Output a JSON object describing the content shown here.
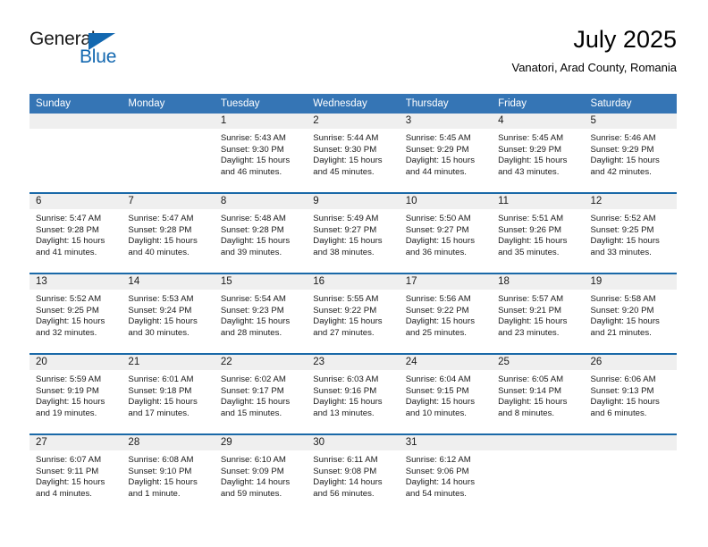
{
  "brand": {
    "name_top": "General",
    "name_bottom": "Blue",
    "triangle_color": "#1368b0",
    "text_color": "#1a1a1a"
  },
  "header": {
    "title": "July 2025",
    "subtitle": "Vanatori, Arad County, Romania"
  },
  "theme": {
    "header_blue": "#3575b5",
    "row_divider_blue": "#1a69a8",
    "day_band_gray": "#efefef"
  },
  "calendar": {
    "weekdays": [
      "Sunday",
      "Monday",
      "Tuesday",
      "Wednesday",
      "Thursday",
      "Friday",
      "Saturday"
    ],
    "weeks": [
      [
        {
          "day": "",
          "sunrise": "",
          "sunset": "",
          "daylight_line1": "",
          "daylight_line2": ""
        },
        {
          "day": "",
          "sunrise": "",
          "sunset": "",
          "daylight_line1": "",
          "daylight_line2": ""
        },
        {
          "day": "1",
          "sunrise": "Sunrise: 5:43 AM",
          "sunset": "Sunset: 9:30 PM",
          "daylight_line1": "Daylight: 15 hours",
          "daylight_line2": "and 46 minutes."
        },
        {
          "day": "2",
          "sunrise": "Sunrise: 5:44 AM",
          "sunset": "Sunset: 9:30 PM",
          "daylight_line1": "Daylight: 15 hours",
          "daylight_line2": "and 45 minutes."
        },
        {
          "day": "3",
          "sunrise": "Sunrise: 5:45 AM",
          "sunset": "Sunset: 9:29 PM",
          "daylight_line1": "Daylight: 15 hours",
          "daylight_line2": "and 44 minutes."
        },
        {
          "day": "4",
          "sunrise": "Sunrise: 5:45 AM",
          "sunset": "Sunset: 9:29 PM",
          "daylight_line1": "Daylight: 15 hours",
          "daylight_line2": "and 43 minutes."
        },
        {
          "day": "5",
          "sunrise": "Sunrise: 5:46 AM",
          "sunset": "Sunset: 9:29 PM",
          "daylight_line1": "Daylight: 15 hours",
          "daylight_line2": "and 42 minutes."
        }
      ],
      [
        {
          "day": "6",
          "sunrise": "Sunrise: 5:47 AM",
          "sunset": "Sunset: 9:28 PM",
          "daylight_line1": "Daylight: 15 hours",
          "daylight_line2": "and 41 minutes."
        },
        {
          "day": "7",
          "sunrise": "Sunrise: 5:47 AM",
          "sunset": "Sunset: 9:28 PM",
          "daylight_line1": "Daylight: 15 hours",
          "daylight_line2": "and 40 minutes."
        },
        {
          "day": "8",
          "sunrise": "Sunrise: 5:48 AM",
          "sunset": "Sunset: 9:28 PM",
          "daylight_line1": "Daylight: 15 hours",
          "daylight_line2": "and 39 minutes."
        },
        {
          "day": "9",
          "sunrise": "Sunrise: 5:49 AM",
          "sunset": "Sunset: 9:27 PM",
          "daylight_line1": "Daylight: 15 hours",
          "daylight_line2": "and 38 minutes."
        },
        {
          "day": "10",
          "sunrise": "Sunrise: 5:50 AM",
          "sunset": "Sunset: 9:27 PM",
          "daylight_line1": "Daylight: 15 hours",
          "daylight_line2": "and 36 minutes."
        },
        {
          "day": "11",
          "sunrise": "Sunrise: 5:51 AM",
          "sunset": "Sunset: 9:26 PM",
          "daylight_line1": "Daylight: 15 hours",
          "daylight_line2": "and 35 minutes."
        },
        {
          "day": "12",
          "sunrise": "Sunrise: 5:52 AM",
          "sunset": "Sunset: 9:25 PM",
          "daylight_line1": "Daylight: 15 hours",
          "daylight_line2": "and 33 minutes."
        }
      ],
      [
        {
          "day": "13",
          "sunrise": "Sunrise: 5:52 AM",
          "sunset": "Sunset: 9:25 PM",
          "daylight_line1": "Daylight: 15 hours",
          "daylight_line2": "and 32 minutes."
        },
        {
          "day": "14",
          "sunrise": "Sunrise: 5:53 AM",
          "sunset": "Sunset: 9:24 PM",
          "daylight_line1": "Daylight: 15 hours",
          "daylight_line2": "and 30 minutes."
        },
        {
          "day": "15",
          "sunrise": "Sunrise: 5:54 AM",
          "sunset": "Sunset: 9:23 PM",
          "daylight_line1": "Daylight: 15 hours",
          "daylight_line2": "and 28 minutes."
        },
        {
          "day": "16",
          "sunrise": "Sunrise: 5:55 AM",
          "sunset": "Sunset: 9:22 PM",
          "daylight_line1": "Daylight: 15 hours",
          "daylight_line2": "and 27 minutes."
        },
        {
          "day": "17",
          "sunrise": "Sunrise: 5:56 AM",
          "sunset": "Sunset: 9:22 PM",
          "daylight_line1": "Daylight: 15 hours",
          "daylight_line2": "and 25 minutes."
        },
        {
          "day": "18",
          "sunrise": "Sunrise: 5:57 AM",
          "sunset": "Sunset: 9:21 PM",
          "daylight_line1": "Daylight: 15 hours",
          "daylight_line2": "and 23 minutes."
        },
        {
          "day": "19",
          "sunrise": "Sunrise: 5:58 AM",
          "sunset": "Sunset: 9:20 PM",
          "daylight_line1": "Daylight: 15 hours",
          "daylight_line2": "and 21 minutes."
        }
      ],
      [
        {
          "day": "20",
          "sunrise": "Sunrise: 5:59 AM",
          "sunset": "Sunset: 9:19 PM",
          "daylight_line1": "Daylight: 15 hours",
          "daylight_line2": "and 19 minutes."
        },
        {
          "day": "21",
          "sunrise": "Sunrise: 6:01 AM",
          "sunset": "Sunset: 9:18 PM",
          "daylight_line1": "Daylight: 15 hours",
          "daylight_line2": "and 17 minutes."
        },
        {
          "day": "22",
          "sunrise": "Sunrise: 6:02 AM",
          "sunset": "Sunset: 9:17 PM",
          "daylight_line1": "Daylight: 15 hours",
          "daylight_line2": "and 15 minutes."
        },
        {
          "day": "23",
          "sunrise": "Sunrise: 6:03 AM",
          "sunset": "Sunset: 9:16 PM",
          "daylight_line1": "Daylight: 15 hours",
          "daylight_line2": "and 13 minutes."
        },
        {
          "day": "24",
          "sunrise": "Sunrise: 6:04 AM",
          "sunset": "Sunset: 9:15 PM",
          "daylight_line1": "Daylight: 15 hours",
          "daylight_line2": "and 10 minutes."
        },
        {
          "day": "25",
          "sunrise": "Sunrise: 6:05 AM",
          "sunset": "Sunset: 9:14 PM",
          "daylight_line1": "Daylight: 15 hours",
          "daylight_line2": "and 8 minutes."
        },
        {
          "day": "26",
          "sunrise": "Sunrise: 6:06 AM",
          "sunset": "Sunset: 9:13 PM",
          "daylight_line1": "Daylight: 15 hours",
          "daylight_line2": "and 6 minutes."
        }
      ],
      [
        {
          "day": "27",
          "sunrise": "Sunrise: 6:07 AM",
          "sunset": "Sunset: 9:11 PM",
          "daylight_line1": "Daylight: 15 hours",
          "daylight_line2": "and 4 minutes."
        },
        {
          "day": "28",
          "sunrise": "Sunrise: 6:08 AM",
          "sunset": "Sunset: 9:10 PM",
          "daylight_line1": "Daylight: 15 hours",
          "daylight_line2": "and 1 minute."
        },
        {
          "day": "29",
          "sunrise": "Sunrise: 6:10 AM",
          "sunset": "Sunset: 9:09 PM",
          "daylight_line1": "Daylight: 14 hours",
          "daylight_line2": "and 59 minutes."
        },
        {
          "day": "30",
          "sunrise": "Sunrise: 6:11 AM",
          "sunset": "Sunset: 9:08 PM",
          "daylight_line1": "Daylight: 14 hours",
          "daylight_line2": "and 56 minutes."
        },
        {
          "day": "31",
          "sunrise": "Sunrise: 6:12 AM",
          "sunset": "Sunset: 9:06 PM",
          "daylight_line1": "Daylight: 14 hours",
          "daylight_line2": "and 54 minutes."
        },
        {
          "day": "",
          "sunrise": "",
          "sunset": "",
          "daylight_line1": "",
          "daylight_line2": ""
        },
        {
          "day": "",
          "sunrise": "",
          "sunset": "",
          "daylight_line1": "",
          "daylight_line2": ""
        }
      ]
    ]
  }
}
